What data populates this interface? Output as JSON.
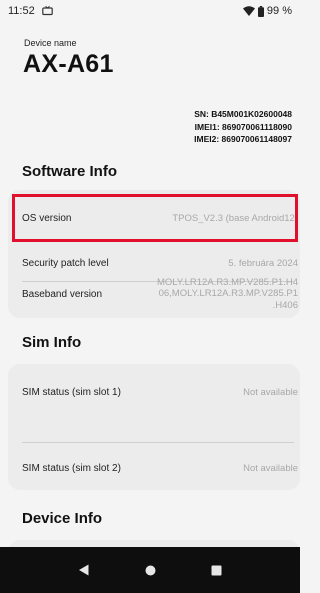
{
  "status_bar": {
    "time": "11:52",
    "battery": "99 %",
    "left_icon": "tv-icon",
    "signal_icon": "wifi-signal-icon",
    "battery_icon": "battery-icon"
  },
  "device": {
    "name_label": "Device name",
    "model": "AX-A61",
    "sn": "SN: B45M001K02600048",
    "imei1": "IMEI1: 869070061118090",
    "imei2": "IMEI2: 869070061148097"
  },
  "software_info": {
    "title": "Software Info",
    "os_version": {
      "label": "OS version",
      "value": "TPOS_V2.3 (base Android12)"
    },
    "security_patch": {
      "label": "Security patch level",
      "value": "5. februára 2024"
    },
    "baseband": {
      "label": "Baseband version",
      "value_line1": "MOLY.LR12A.R3.MP.V285.P1.H4",
      "value_line2": "06,MOLY.LR12A.R3.MP.V285.P1",
      "value_line3": ".H406"
    }
  },
  "sim_info": {
    "title": "Sim Info",
    "slot1": {
      "label": "SIM status (sim slot 1)",
      "value": "Not available"
    },
    "slot2": {
      "label": "SIM status (sim slot 2)",
      "value": "Not available"
    }
  },
  "device_info": {
    "title": "Device Info"
  },
  "nav": {
    "back_icon": "back-triangle-icon",
    "home_icon": "home-circle-icon",
    "recents_icon": "recents-square-icon"
  },
  "colors": {
    "background": "#f4f4f4",
    "card": "#ececec",
    "highlight": "#e0102c",
    "nav_bar": "#0e0e0e",
    "secondary_text": "#a8a8a8"
  }
}
